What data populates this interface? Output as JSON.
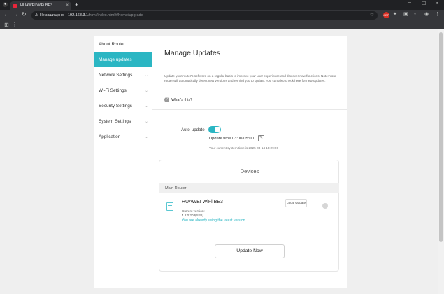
{
  "browser": {
    "tab_title": "HUAWEI WiFi BE3",
    "tab_close": "×",
    "new_tab": "+",
    "url_warning_label": "Не защищено",
    "url_host": "192.168.3.1",
    "url_path": "/html/index.html#/home/upgrade",
    "colors": {
      "chrome_dark": "#202124",
      "chrome_mid": "#35363a",
      "favicon": "#e8253a"
    }
  },
  "sidebar": {
    "items": [
      {
        "label": "About Router",
        "active": false,
        "has_chevron": false
      },
      {
        "label": "Manage updates",
        "active": true,
        "has_chevron": false
      },
      {
        "label": "Network Settings",
        "active": false,
        "has_chevron": true
      },
      {
        "label": "Wi-Fi Settings",
        "active": false,
        "has_chevron": true
      },
      {
        "label": "Security Settings",
        "active": false,
        "has_chevron": true
      },
      {
        "label": "System Settings",
        "active": false,
        "has_chevron": true
      },
      {
        "label": "Application",
        "active": false,
        "has_chevron": true
      }
    ],
    "chevron_icon": "chevron-down-icon"
  },
  "main": {
    "title": "Manage Updates",
    "description": "Update your router's software on a regular basis to improve your user experience and discover new functions. Note: Your router will automatically detect new versions and remind you to update. You can also check here for new updates.",
    "whats_new_label": "What's this?",
    "auto_update": {
      "label": "Auto-update",
      "enabled": true,
      "time_label": "Update time 03:00-05:00",
      "system_time": "Your current system time is 2025-03-14 13:29:06"
    }
  },
  "devices": {
    "title": "Devices",
    "group_label": "Main Router",
    "router": {
      "name": "HUAWEI WiFi BE3",
      "current_version_label": "Current version:",
      "version": "4.2.0.203(SP6)",
      "status": "You are already using the latest version.",
      "local_update_label": "Local Update"
    },
    "update_now_label": "Update Now"
  },
  "colors": {
    "accent": "#2bb6c3",
    "page_bg": "#efefef"
  }
}
